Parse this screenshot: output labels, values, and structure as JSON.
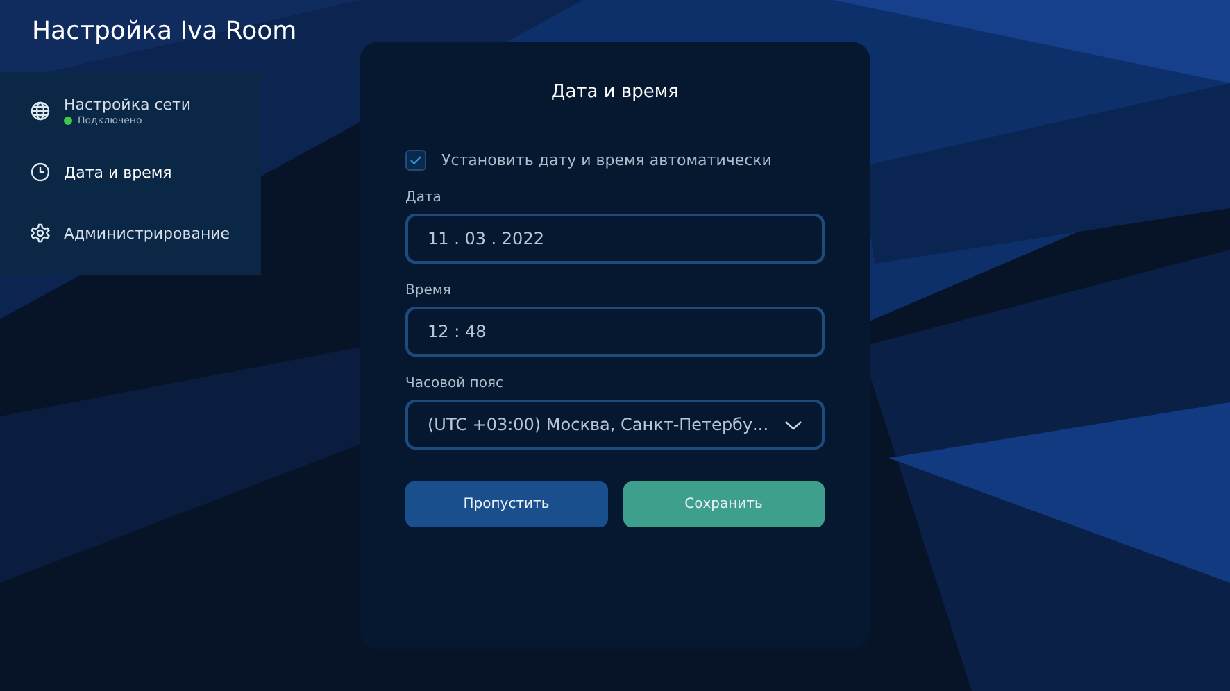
{
  "window": {
    "title": "Настройка Iva Room"
  },
  "sidebar": {
    "items": [
      {
        "kind": "network",
        "label": "Настройка сети",
        "status": {
          "text": "Подключено",
          "color": "#3fc94b"
        },
        "selected": false
      },
      {
        "kind": "clock",
        "label": "Дата и время",
        "selected": true
      },
      {
        "kind": "gear",
        "label": "Администрирование",
        "selected": false
      }
    ]
  },
  "dialog": {
    "title": "Дата и время",
    "auto_checkbox": {
      "label": "Установить дату и время автоматически",
      "checked": true
    },
    "fields": [
      {
        "kind": "input",
        "label": "Дата",
        "value": "11 . 03 . 2022"
      },
      {
        "kind": "input",
        "label": "Время",
        "value": "12 : 48"
      },
      {
        "kind": "select",
        "label": "Часовой пояс",
        "value": "(UTC +03:00) Москва, Санкт-Петербу..."
      }
    ],
    "buttons": [
      {
        "kind": "secondary",
        "label": "Пропустить"
      },
      {
        "kind": "primary",
        "label": "Сохранить"
      }
    ]
  }
}
